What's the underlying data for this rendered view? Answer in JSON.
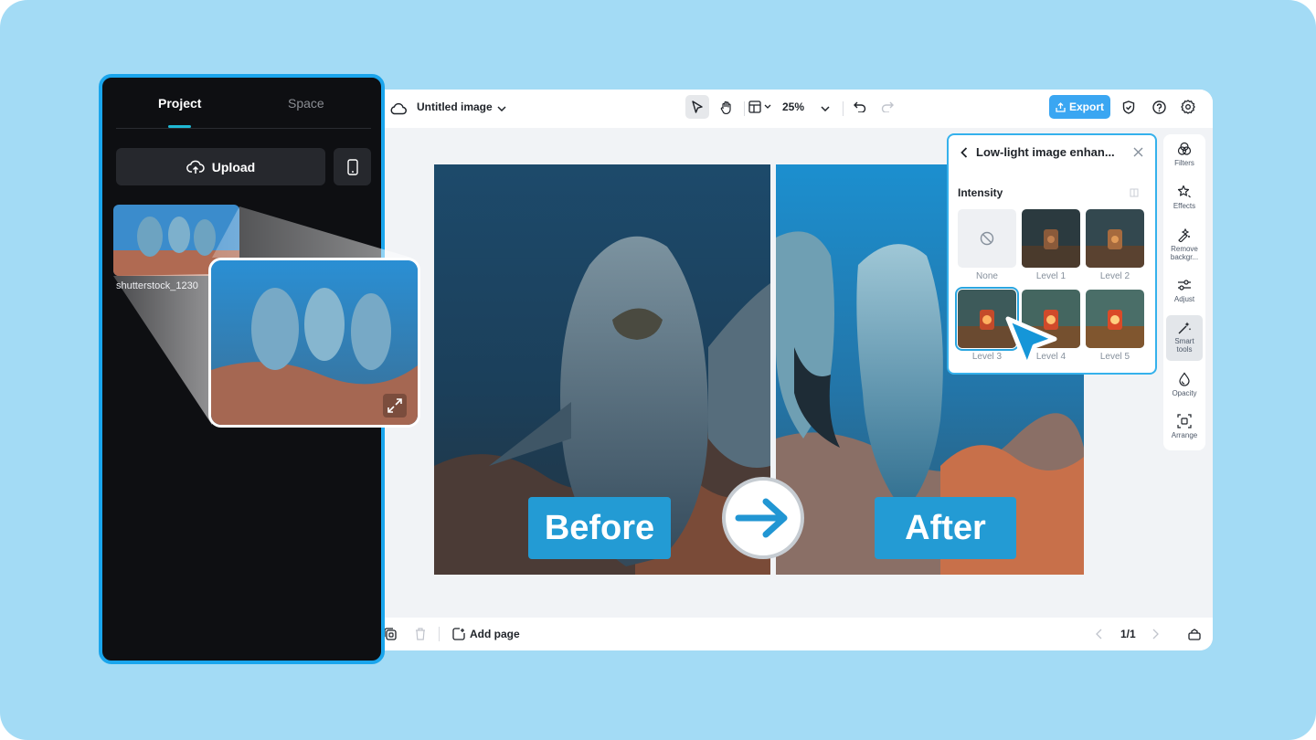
{
  "editor": {
    "doc_title": "Untitled image",
    "zoom": "25%",
    "export_label": "Export",
    "add_page_label": "Add page",
    "page_indicator": "1/1"
  },
  "sidebar": {
    "tabs": [
      {
        "label": "Project"
      },
      {
        "label": "Space"
      }
    ],
    "upload_label": "Upload",
    "asset_name": "shutterstock_1230"
  },
  "comparison": {
    "before_label": "Before",
    "after_label": "After"
  },
  "panel": {
    "title": "Low-light image enhan...",
    "intensity_label": "Intensity",
    "levels": [
      {
        "label": "None"
      },
      {
        "label": "Level 1"
      },
      {
        "label": "Level 2"
      },
      {
        "label": "Level 3"
      },
      {
        "label": "Level 4"
      },
      {
        "label": "Level 5"
      }
    ],
    "selected_level": "Level 3"
  },
  "rail": {
    "items": [
      {
        "label": "Filters",
        "icon": "filters-icon"
      },
      {
        "label": "Effects",
        "icon": "effects-icon"
      },
      {
        "label": "Remove backgr...",
        "icon": "remove-bg-icon"
      },
      {
        "label": "Adjust",
        "icon": "adjust-icon"
      },
      {
        "label": "Smart tools",
        "icon": "magic-wand-icon"
      },
      {
        "label": "Opacity",
        "icon": "opacity-icon"
      },
      {
        "label": "Arrange",
        "icon": "arrange-icon"
      }
    ],
    "active": "Smart tools"
  },
  "colors": {
    "background": "#a3dbf5",
    "accent": "#239bd4",
    "export": "#3aa6f2",
    "sidebar": "#0e0f12",
    "sidebar_border": "#1aa5ec"
  }
}
